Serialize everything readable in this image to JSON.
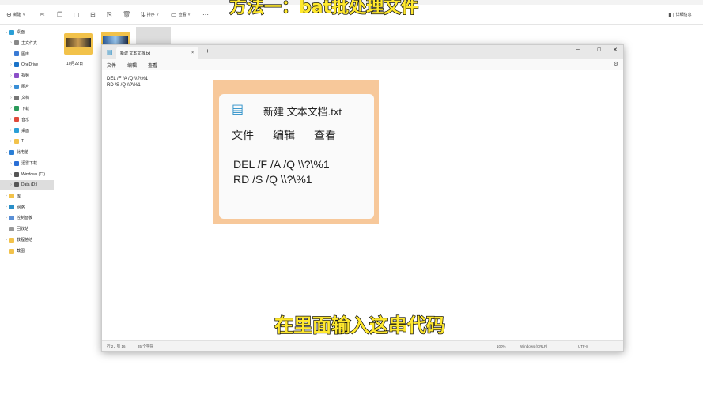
{
  "explorer": {
    "toolbar": {
      "new": "新建",
      "sort": "排序",
      "view": "查看",
      "more": "···",
      "details": "详细信息"
    },
    "sidebar": [
      {
        "label": "桌面",
        "color": "#2a9fd6",
        "chev": "⌄"
      },
      {
        "label": "主文件夹",
        "color": "#888",
        "chev": "›"
      },
      {
        "label": "图库",
        "color": "#3a7bd5",
        "chev": ""
      },
      {
        "label": "OneDrive",
        "color": "#1a73c8",
        "chev": "›"
      },
      {
        "label": "视频",
        "color": "#8b4fc8",
        "chev": "›"
      },
      {
        "label": "图片",
        "color": "#3a8fd6",
        "chev": "›"
      },
      {
        "label": "文档",
        "color": "#777",
        "chev": "›"
      },
      {
        "label": "下载",
        "color": "#2a9a5a",
        "chev": "›"
      },
      {
        "label": "音乐",
        "color": "#e04a3a",
        "chev": "›"
      },
      {
        "label": "桌面",
        "color": "#2a9fd6",
        "chev": "›"
      },
      {
        "label": "T",
        "color": "#f2c24a",
        "chev": "›"
      },
      {
        "label": "此电脑",
        "color": "#2a7fd6",
        "chev": "⌄"
      },
      {
        "label": "迅雷下载",
        "color": "#2a6fd6",
        "chev": "›"
      },
      {
        "label": "Windows (C:)",
        "color": "#555",
        "chev": "›"
      },
      {
        "label": "Data (D:)",
        "color": "#555",
        "chev": "›"
      },
      {
        "label": "库",
        "color": "#f2c24a",
        "chev": "›"
      },
      {
        "label": "网络",
        "color": "#2a8fc8",
        "chev": "›"
      },
      {
        "label": "控制面板",
        "color": "#5a8fd6",
        "chev": "›"
      },
      {
        "label": "回收站",
        "color": "#999",
        "chev": ""
      },
      {
        "label": "教程总结",
        "color": "#f2c24a",
        "chev": "›"
      },
      {
        "label": "截图",
        "color": "#f2c24a",
        "chev": ""
      }
    ],
    "folders": [
      {
        "label": "10月22日"
      }
    ]
  },
  "notepad": {
    "tab_title": "新建 文本文档.txt",
    "menu": [
      "文件",
      "编辑",
      "查看"
    ],
    "content": "DEL /F /A /Q \\\\?\\%1\nRD /S /Q \\\\?\\%1",
    "status": {
      "position": "行 2，列 16",
      "chars": "35 个字符",
      "zoom": "100%",
      "eol": "Windows (CRLF)",
      "encoding": "UTF-8"
    }
  },
  "captions": {
    "title": "方法一：bat批处理文件",
    "subtitle": "在里面输入这串代码"
  }
}
